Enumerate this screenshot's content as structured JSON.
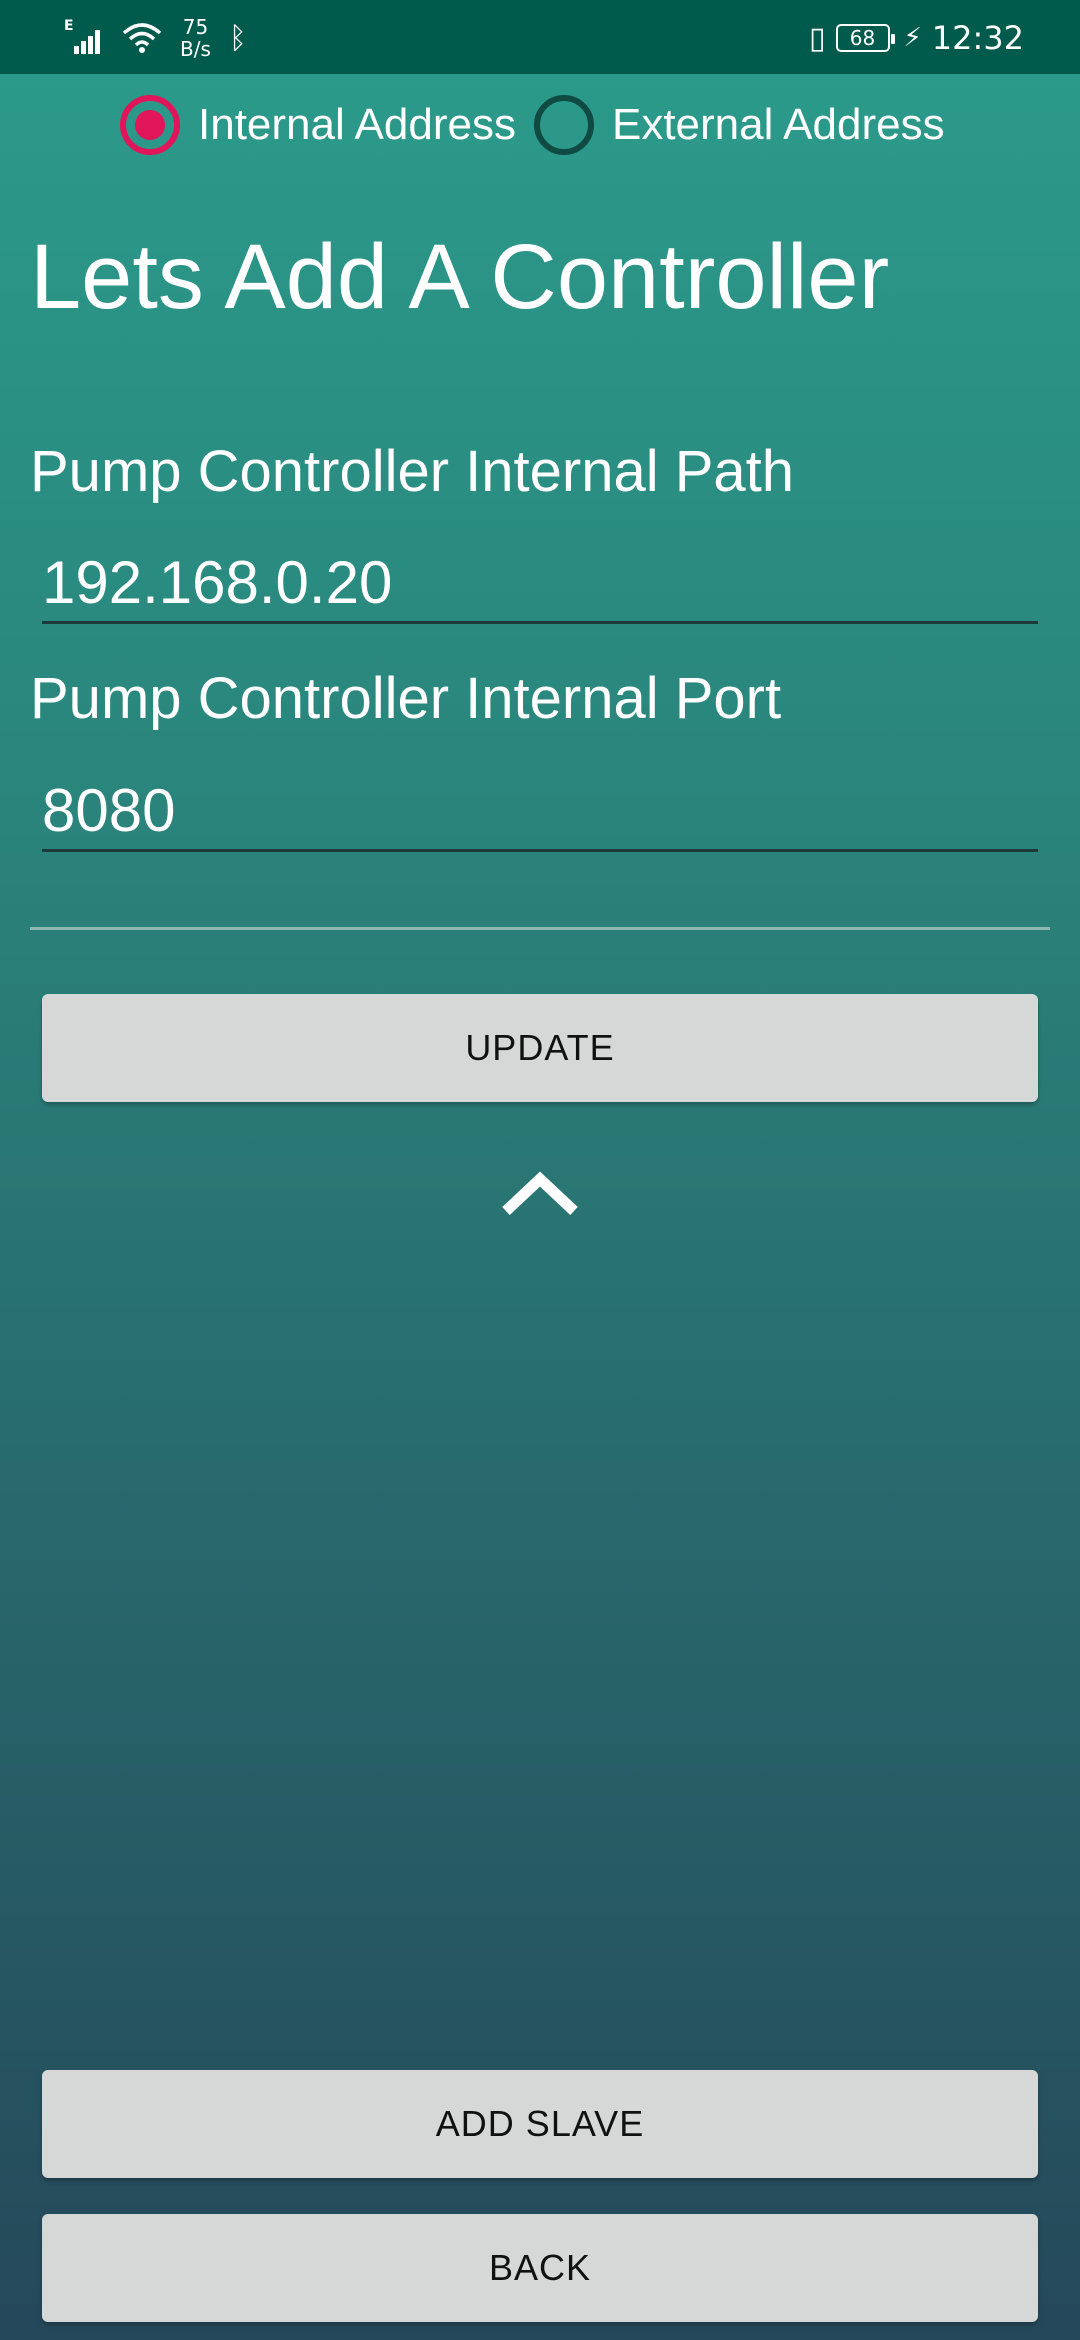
{
  "status_bar": {
    "network_type": "E",
    "net_speed_value": "75",
    "net_speed_unit": "B/s",
    "battery_level": "68",
    "time": "12:32",
    "icons": [
      "signal-icon",
      "wifi-icon",
      "bluetooth-icon",
      "vibrate-icon",
      "battery-icon",
      "charging-icon"
    ]
  },
  "address_mode": {
    "options": [
      {
        "label": "Internal Address",
        "selected": true
      },
      {
        "label": "External Address",
        "selected": false
      }
    ],
    "accent_color": "#e0155a"
  },
  "page": {
    "title": "Lets Add A Controller"
  },
  "form": {
    "path_label": "Pump Controller Internal Path",
    "path_value": "192.168.0.20",
    "port_label": "Pump Controller Internal Port",
    "port_value": "8080"
  },
  "buttons": {
    "update": "UPDATE",
    "add_slave": "ADD SLAVE",
    "back": "BACK"
  },
  "collapse_icon": "chevron-up-icon"
}
